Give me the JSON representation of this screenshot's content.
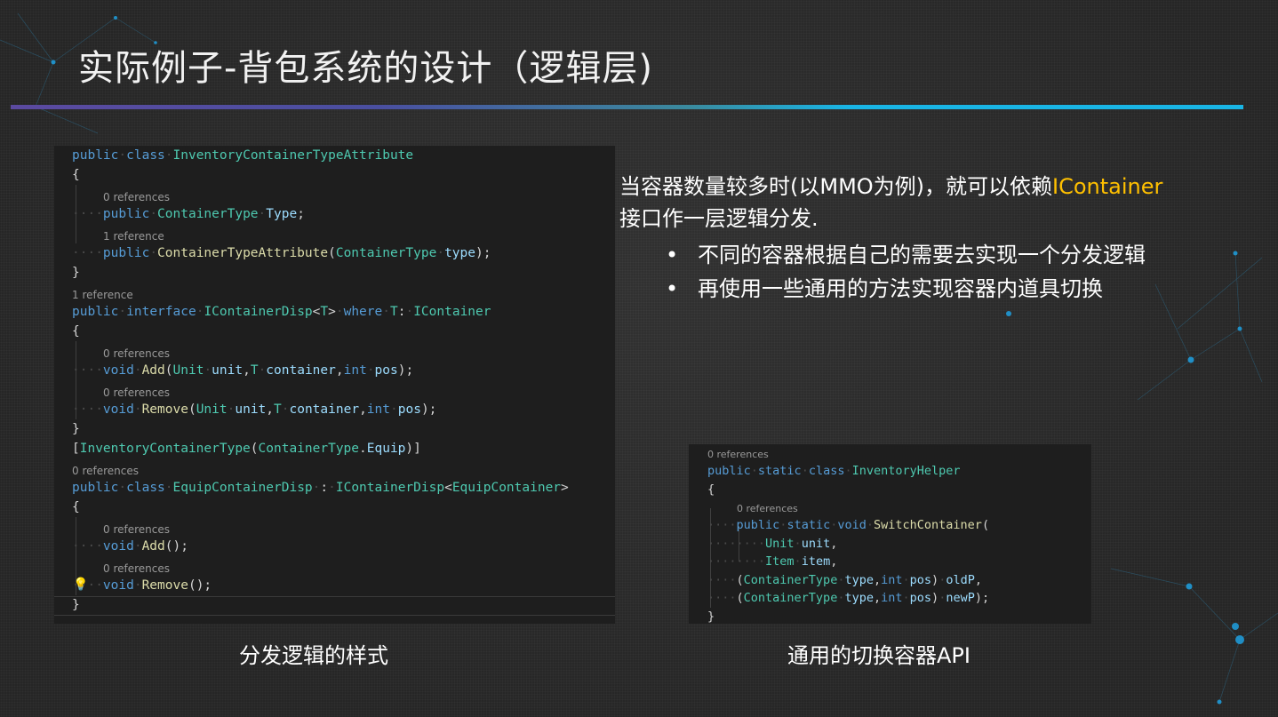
{
  "slide": {
    "title": "实际例子-背包系统的设计（逻辑层)",
    "accent_color": "#19b5e5",
    "highlight_color": "#ffc000"
  },
  "description": {
    "line1_prefix": "当容器数量较多时(以MMO为例)，就可以依赖",
    "line1_highlight": "IContainer",
    "line2": "接口作一层逻辑分发.",
    "bullets": [
      "不同的容器根据自己的需要去实现一个分发逻辑",
      "再使用一些通用的方法实现容器内道具切换"
    ]
  },
  "captions": {
    "left": "分发逻辑的样式",
    "right": "通用的切换容器API"
  },
  "code_left": {
    "lines": [
      {
        "kind": "code",
        "tokens": [
          [
            "kw",
            "public"
          ],
          [
            "ws",
            "·"
          ],
          [
            "kw",
            "class"
          ],
          [
            "ws",
            "·"
          ],
          [
            "ty",
            "InventoryContainerTypeAttribute"
          ]
        ]
      },
      {
        "kind": "code",
        "tokens": [
          [
            "pl",
            "{"
          ]
        ]
      },
      {
        "kind": "ref",
        "indent": 1,
        "text": "0 references"
      },
      {
        "kind": "code",
        "tokens": [
          [
            "ws",
            "····"
          ],
          [
            "kw",
            "public"
          ],
          [
            "ws",
            "·"
          ],
          [
            "ty",
            "ContainerType"
          ],
          [
            "ws",
            "·"
          ],
          [
            "id",
            "Type"
          ],
          [
            "pl",
            ";"
          ]
        ]
      },
      {
        "kind": "ref",
        "indent": 1,
        "text": "1 reference"
      },
      {
        "kind": "code",
        "tokens": [
          [
            "ws",
            "····"
          ],
          [
            "kw",
            "public"
          ],
          [
            "ws",
            "·"
          ],
          [
            "fn",
            "ContainerTypeAttribute"
          ],
          [
            "pl",
            "("
          ],
          [
            "ty",
            "ContainerType"
          ],
          [
            "ws",
            "·"
          ],
          [
            "id",
            "type"
          ],
          [
            "pl",
            ");"
          ]
        ]
      },
      {
        "kind": "code",
        "tokens": [
          [
            "pl",
            "}"
          ]
        ]
      },
      {
        "kind": "ref",
        "indent": 0,
        "text": "1 reference"
      },
      {
        "kind": "code",
        "tokens": [
          [
            "kw",
            "public"
          ],
          [
            "ws",
            "·"
          ],
          [
            "kw",
            "interface"
          ],
          [
            "ws",
            "·"
          ],
          [
            "ty",
            "IContainerDisp"
          ],
          [
            "pl",
            "<"
          ],
          [
            "ty",
            "T"
          ],
          [
            "pl",
            ">"
          ],
          [
            "ws",
            "·"
          ],
          [
            "kw",
            "where"
          ],
          [
            "ws",
            "·"
          ],
          [
            "ty",
            "T"
          ],
          [
            "pl",
            ":"
          ],
          [
            "ws",
            "·"
          ],
          [
            "ty",
            "IContainer"
          ]
        ]
      },
      {
        "kind": "code",
        "tokens": [
          [
            "pl",
            "{"
          ]
        ]
      },
      {
        "kind": "ref",
        "indent": 1,
        "text": "0 references"
      },
      {
        "kind": "code",
        "tokens": [
          [
            "ws",
            "····"
          ],
          [
            "kw",
            "void"
          ],
          [
            "ws",
            "·"
          ],
          [
            "fn",
            "Add"
          ],
          [
            "pl",
            "("
          ],
          [
            "ty",
            "Unit"
          ],
          [
            "ws",
            "·"
          ],
          [
            "id",
            "unit"
          ],
          [
            "pl",
            ","
          ],
          [
            "ty",
            "T"
          ],
          [
            "ws",
            "·"
          ],
          [
            "id",
            "container"
          ],
          [
            "pl",
            ","
          ],
          [
            "kw",
            "int"
          ],
          [
            "ws",
            "·"
          ],
          [
            "id",
            "pos"
          ],
          [
            "pl",
            ");"
          ]
        ]
      },
      {
        "kind": "ref",
        "indent": 1,
        "text": "0 references"
      },
      {
        "kind": "code",
        "tokens": [
          [
            "ws",
            "····"
          ],
          [
            "kw",
            "void"
          ],
          [
            "ws",
            "·"
          ],
          [
            "fn",
            "Remove"
          ],
          [
            "pl",
            "("
          ],
          [
            "ty",
            "Unit"
          ],
          [
            "ws",
            "·"
          ],
          [
            "id",
            "unit"
          ],
          [
            "pl",
            ","
          ],
          [
            "ty",
            "T"
          ],
          [
            "ws",
            "·"
          ],
          [
            "id",
            "container"
          ],
          [
            "pl",
            ","
          ],
          [
            "kw",
            "int"
          ],
          [
            "ws",
            "·"
          ],
          [
            "id",
            "pos"
          ],
          [
            "pl",
            ");"
          ]
        ]
      },
      {
        "kind": "code",
        "tokens": [
          [
            "pl",
            "}"
          ]
        ]
      },
      {
        "kind": "code",
        "tokens": [
          [
            "pl",
            "["
          ],
          [
            "ty",
            "InventoryContainerType"
          ],
          [
            "pl",
            "("
          ],
          [
            "ty",
            "ContainerType"
          ],
          [
            "pl",
            "."
          ],
          [
            "id",
            "Equip"
          ],
          [
            "pl",
            ")]"
          ]
        ]
      },
      {
        "kind": "ref",
        "indent": 0,
        "text": "0 references"
      },
      {
        "kind": "code",
        "tokens": [
          [
            "kw",
            "public"
          ],
          [
            "ws",
            "·"
          ],
          [
            "kw",
            "class"
          ],
          [
            "ws",
            "·"
          ],
          [
            "ty",
            "EquipContainerDisp"
          ],
          [
            "ws",
            "·"
          ],
          [
            "pl",
            ":"
          ],
          [
            "ws",
            "·"
          ],
          [
            "ty",
            "IContainerDisp"
          ],
          [
            "pl",
            "<"
          ],
          [
            "ty",
            "EquipContainer"
          ],
          [
            "pl",
            ">"
          ]
        ]
      },
      {
        "kind": "code",
        "tokens": [
          [
            "pl",
            "{"
          ]
        ]
      },
      {
        "kind": "ref",
        "indent": 1,
        "text": "0 references"
      },
      {
        "kind": "code",
        "tokens": [
          [
            "ws",
            "····"
          ],
          [
            "kw",
            "void"
          ],
          [
            "ws",
            "·"
          ],
          [
            "fn",
            "Add"
          ],
          [
            "pl",
            "();"
          ]
        ]
      },
      {
        "kind": "ref",
        "indent": 1,
        "text": "0 references"
      },
      {
        "kind": "code",
        "tokens": [
          [
            "ws",
            "····"
          ],
          [
            "kw",
            "void"
          ],
          [
            "ws",
            "·"
          ],
          [
            "fn",
            "Remove"
          ],
          [
            "pl",
            "();"
          ]
        ]
      },
      {
        "kind": "code",
        "tokens": [
          [
            "pl",
            "}"
          ]
        ]
      }
    ]
  },
  "code_right": {
    "lines": [
      {
        "kind": "ref",
        "indent": 0,
        "text": "0 references"
      },
      {
        "kind": "code",
        "tokens": [
          [
            "kw",
            "public"
          ],
          [
            "ws",
            "·"
          ],
          [
            "kw",
            "static"
          ],
          [
            "ws",
            "·"
          ],
          [
            "kw",
            "class"
          ],
          [
            "ws",
            "·"
          ],
          [
            "ty",
            "InventoryHelper"
          ]
        ]
      },
      {
        "kind": "code",
        "tokens": [
          [
            "pl",
            "{"
          ]
        ]
      },
      {
        "kind": "ref",
        "indent": 1,
        "text": "0 references"
      },
      {
        "kind": "code",
        "tokens": [
          [
            "ws",
            "····"
          ],
          [
            "kw",
            "public"
          ],
          [
            "ws",
            "·"
          ],
          [
            "kw",
            "static"
          ],
          [
            "ws",
            "·"
          ],
          [
            "kw",
            "void"
          ],
          [
            "ws",
            "·"
          ],
          [
            "fn",
            "SwitchContainer"
          ],
          [
            "pl",
            "("
          ]
        ]
      },
      {
        "kind": "code",
        "tokens": [
          [
            "ws",
            "········"
          ],
          [
            "ty",
            "Unit"
          ],
          [
            "ws",
            "·"
          ],
          [
            "id",
            "unit"
          ],
          [
            "pl",
            ","
          ]
        ]
      },
      {
        "kind": "code",
        "tokens": [
          [
            "ws",
            "········"
          ],
          [
            "ty",
            "Item"
          ],
          [
            "ws",
            "·"
          ],
          [
            "id",
            "item"
          ],
          [
            "pl",
            ","
          ]
        ]
      },
      {
        "kind": "code",
        "tokens": [
          [
            "ws",
            "····"
          ],
          [
            "pl",
            "("
          ],
          [
            "ty",
            "ContainerType"
          ],
          [
            "ws",
            "·"
          ],
          [
            "id",
            "type"
          ],
          [
            "pl",
            ","
          ],
          [
            "kw",
            "int"
          ],
          [
            "ws",
            "·"
          ],
          [
            "id",
            "pos"
          ],
          [
            "pl",
            ")"
          ],
          [
            "ws",
            "·"
          ],
          [
            "id",
            "oldP"
          ],
          [
            "pl",
            ","
          ]
        ]
      },
      {
        "kind": "code",
        "tokens": [
          [
            "ws",
            "····"
          ],
          [
            "pl",
            "("
          ],
          [
            "ty",
            "ContainerType"
          ],
          [
            "ws",
            "·"
          ],
          [
            "id",
            "type"
          ],
          [
            "pl",
            ","
          ],
          [
            "kw",
            "int"
          ],
          [
            "ws",
            "·"
          ],
          [
            "id",
            "pos"
          ],
          [
            "pl",
            ")"
          ],
          [
            "ws",
            "·"
          ],
          [
            "id",
            "newP"
          ],
          [
            "pl",
            ");"
          ]
        ]
      },
      {
        "kind": "code",
        "tokens": [
          [
            "pl",
            "}"
          ]
        ]
      }
    ]
  },
  "icons": {
    "quick_action": "lightbulb-icon"
  }
}
